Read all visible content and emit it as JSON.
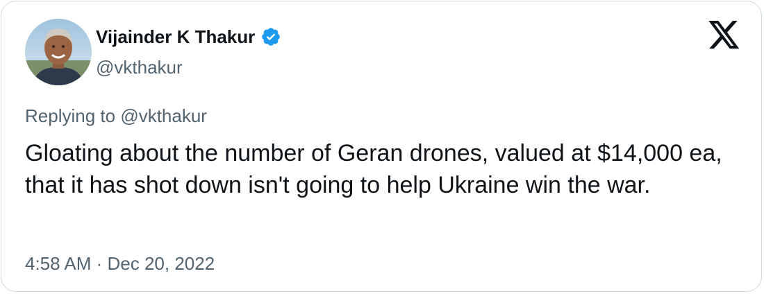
{
  "author": {
    "display_name": "Vijainder K Thakur",
    "handle": "@vkthakur",
    "verified": true,
    "verified_color": "#1d9bf0"
  },
  "platform_icon": "x-logo-icon",
  "reply": {
    "prefix": "Replying to ",
    "mention": "@vkthakur"
  },
  "tweet": {
    "text": "Gloating about the number of Geran drones, valued at $14,000 ea, that it has shot down isn't going to help Ukraine win the war.",
    "timestamp": "4:58 AM · Dec 20, 2022"
  },
  "colors": {
    "text_primary": "#0f1419",
    "text_secondary": "#536471",
    "border": "#cfd9de"
  }
}
